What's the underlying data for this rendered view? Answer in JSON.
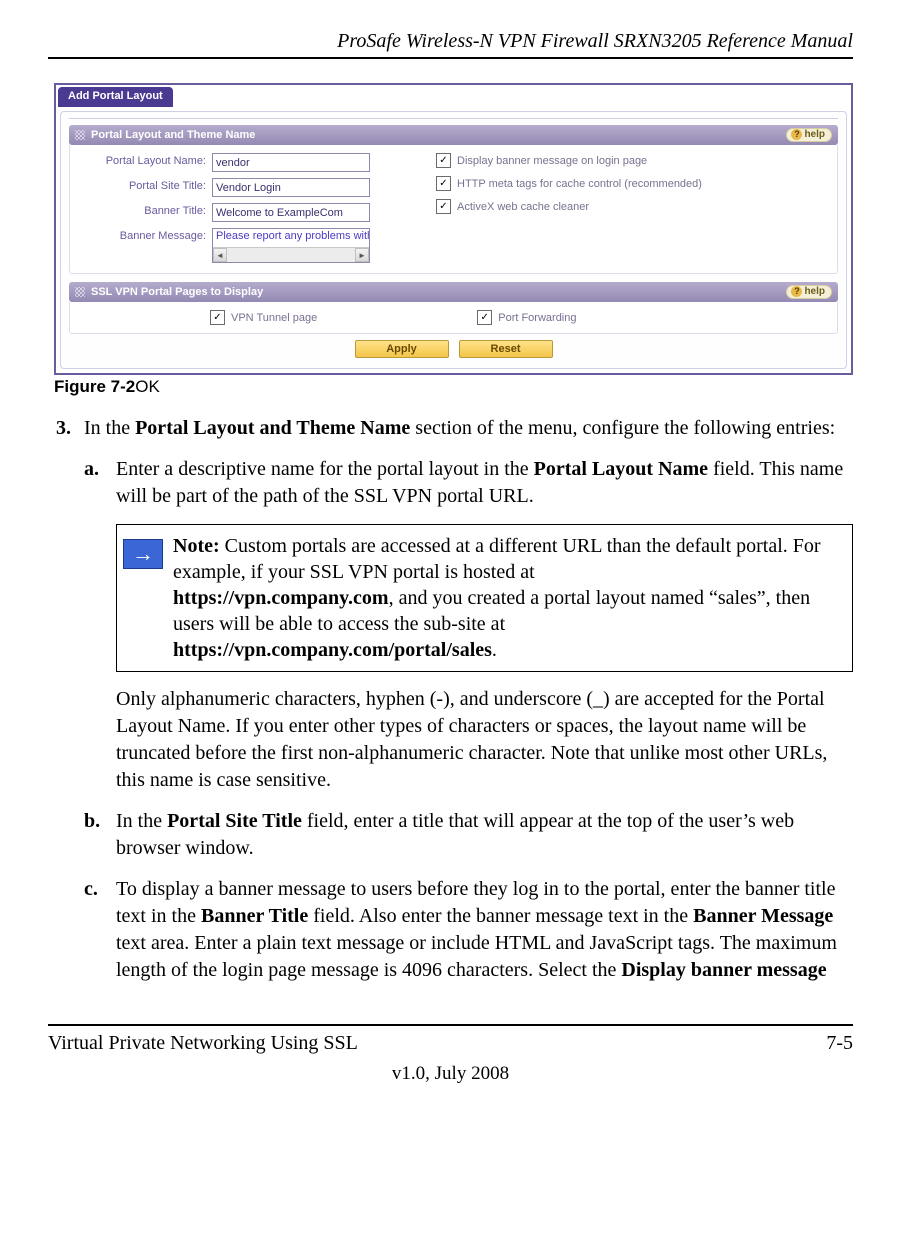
{
  "header": {
    "title": "ProSafe Wireless-N VPN Firewall SRXN3205 Reference Manual"
  },
  "screenshot": {
    "tab": "Add Portal Layout",
    "section1": {
      "title": "Portal Layout and Theme Name",
      "help": "help",
      "labels": {
        "layout_name": "Portal Layout Name:",
        "site_title": "Portal Site Title:",
        "banner_title": "Banner Title:",
        "banner_message": "Banner Message:"
      },
      "values": {
        "layout_name": "vendor",
        "site_title": "Vendor Login",
        "banner_title": "Welcome to ExampleCom",
        "banner_message": "Please report any problems with"
      },
      "checks": {
        "c1": "Display banner message on login page",
        "c2": "HTTP meta tags for cache control (recommended)",
        "c3": "ActiveX web cache cleaner"
      }
    },
    "section2": {
      "title": "SSL VPN Portal Pages to Display",
      "help": "help",
      "opt1": "VPN Tunnel page",
      "opt2": "Port Forwarding"
    },
    "buttons": {
      "apply": "Apply",
      "reset": "Reset"
    }
  },
  "figure_caption": {
    "bold": "Figure 7-2",
    "rest": "OK"
  },
  "step3": {
    "intro_a": "In the ",
    "intro_b": "Portal Layout and Theme Name",
    "intro_c": " section of the menu, configure the following entries:",
    "a": {
      "t1": "Enter a descriptive name for the portal layout in the ",
      "b1": "Portal Layout Name",
      "t2": " field. This name will be part of the path of the SSL VPN portal URL."
    },
    "note": {
      "label": "Note:",
      "l1": " Custom portals are accessed at a different URL than the default portal. For example, if your SSL VPN portal is hosted at ",
      "b1": "https://vpn.company.com",
      "l2": ", and you created a portal layout named “sales”, then users will be able to access the sub-site at ",
      "b2": "https://vpn.company.com/portal/sales",
      "l3": "."
    },
    "a_tail": "Only alphanumeric characters, hyphen (-), and underscore (_) are accepted for the Portal Layout Name. If you enter other types of characters or spaces, the layout name will be truncated before the first non-alphanumeric character. Note that unlike most other URLs, this name is case sensitive.",
    "b": {
      "t1": "In the ",
      "b1": "Portal Site Title",
      "t2": " field, enter a title that will appear at the top of the user’s web browser window."
    },
    "c": {
      "t1": "To display a banner message to users before they log in to the portal, enter the banner title text in the ",
      "b1": "Banner Title",
      "t2": " field. Also enter the banner message text in the ",
      "b2": "Banner Message",
      "t3": " text area. Enter a plain text message or include HTML and JavaScript tags. The maximum length of the login page message is 4096 characters. Select the ",
      "b3": "Display banner message"
    }
  },
  "footer": {
    "left": "Virtual Private Networking Using SSL",
    "right": "7-5",
    "version": "v1.0, July 2008"
  }
}
